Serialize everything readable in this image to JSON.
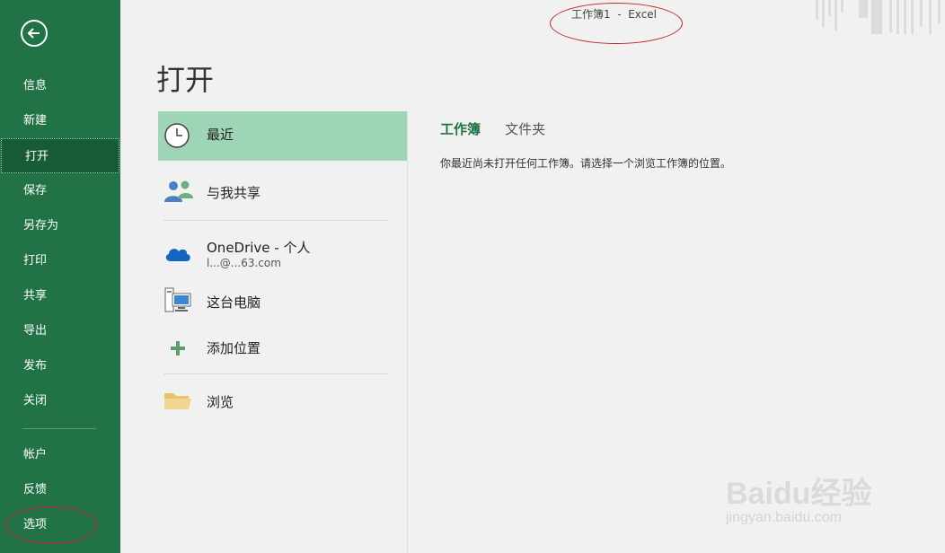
{
  "window": {
    "title": "工作簿1  -  Excel"
  },
  "sidebar": {
    "items": [
      {
        "label": "信息"
      },
      {
        "label": "新建"
      },
      {
        "label": "打开"
      },
      {
        "label": "保存"
      },
      {
        "label": "另存为"
      },
      {
        "label": "打印"
      },
      {
        "label": "共享"
      },
      {
        "label": "导出"
      },
      {
        "label": "发布"
      },
      {
        "label": "关闭"
      }
    ],
    "bottom_items": [
      {
        "label": "帐户"
      },
      {
        "label": "反馈"
      },
      {
        "label": "选项"
      }
    ],
    "active": "打开"
  },
  "main": {
    "title": "打开",
    "locations": {
      "recent": "最近",
      "shared": "与我共享",
      "onedrive": "OneDrive - 个人",
      "onedrive_account": "l...@...63.com",
      "this_pc": "这台电脑",
      "add_place": "添加位置",
      "browse": "浏览"
    },
    "tabs": [
      {
        "label": "工作簿"
      },
      {
        "label": "文件夹"
      }
    ],
    "empty_message": "你最近尚未打开任何工作簿。请选择一个浏览工作簿的位置。"
  },
  "watermark": {
    "main": "Baidu经验",
    "sub": "jingyan.baidu.com"
  },
  "colors": {
    "brand": "#217346",
    "sidebar_active": "#185c37",
    "recent_highlight": "#9fd5b7",
    "annotation": "#c8202a"
  }
}
